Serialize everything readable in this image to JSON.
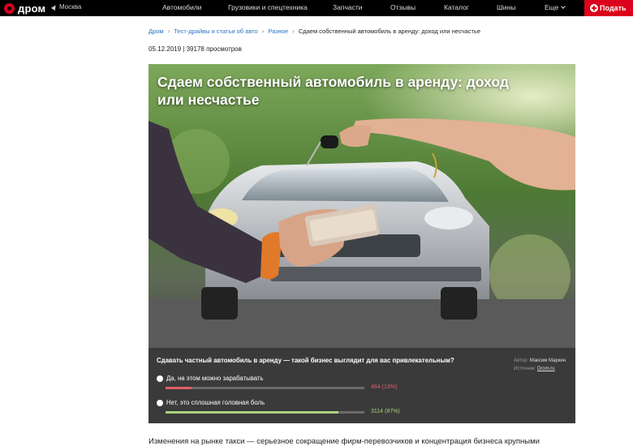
{
  "header": {
    "logo_text": "дром",
    "city": "Москва",
    "nav": [
      "Автомобили",
      "Грузовики и спецтехника",
      "Запчасти",
      "Отзывы",
      "Каталог",
      "Шины",
      "Еще"
    ],
    "post_button": "Подать"
  },
  "breadcrumb": {
    "items": [
      "Дром",
      "Тест-драйвы и статьи об авто",
      "Разное"
    ],
    "current": "Сдаем собственный автомобиль в аренду: доход или несчастье"
  },
  "meta": {
    "date": "05.12.2019",
    "separator": "|",
    "views": "39178 просмотров"
  },
  "article": {
    "title": "Сдаем собственный автомобиль в аренду: доход или несчастье",
    "first_line": "Изменения на рынке такси — серьезное сокращение фирм-перевозчиков и концентрация бизнеса крупными"
  },
  "poll": {
    "question": "Сдавать частный автомобиль в аренду — такой бизнес выглядит для вас привлекательным?",
    "author_label": "Автор:",
    "author": "Максим Маркин",
    "source_label": "Источник:",
    "source": "Drom.ru",
    "options": [
      {
        "label": "Да, на этом можно зарабатывать",
        "result": "464 (13%)",
        "fraction": 0.13,
        "color": "#e0606a"
      },
      {
        "label": "Нет, это сплошная головная боль",
        "result": "3114 (87%)",
        "fraction": 0.87,
        "color": "#a9d47a"
      }
    ]
  },
  "colors": {
    "brand": "#db001b",
    "link": "#2a73c4",
    "poll_bg": "#3a3a3a"
  }
}
